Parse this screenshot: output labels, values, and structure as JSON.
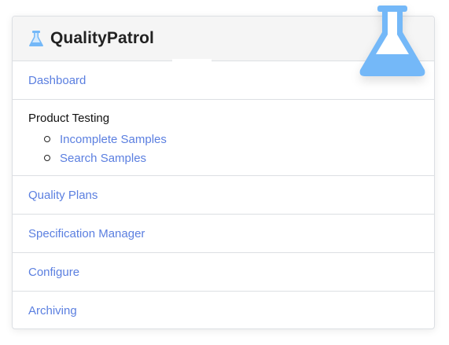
{
  "header": {
    "brand": "QualityPatrol",
    "icon": "flask-icon",
    "accent_color": "#74b8f8"
  },
  "menu": {
    "dashboard": "Dashboard",
    "product_testing": {
      "title": "Product Testing",
      "items": [
        "Incomplete Samples",
        "Search Samples"
      ]
    },
    "quality_plans": "Quality Plans",
    "specification_manager": "Specification Manager",
    "configure": "Configure",
    "archiving": "Archiving"
  },
  "colors": {
    "link": "#5b7fe0",
    "header_bg": "#f5f5f5",
    "border": "#dcdfe3"
  }
}
